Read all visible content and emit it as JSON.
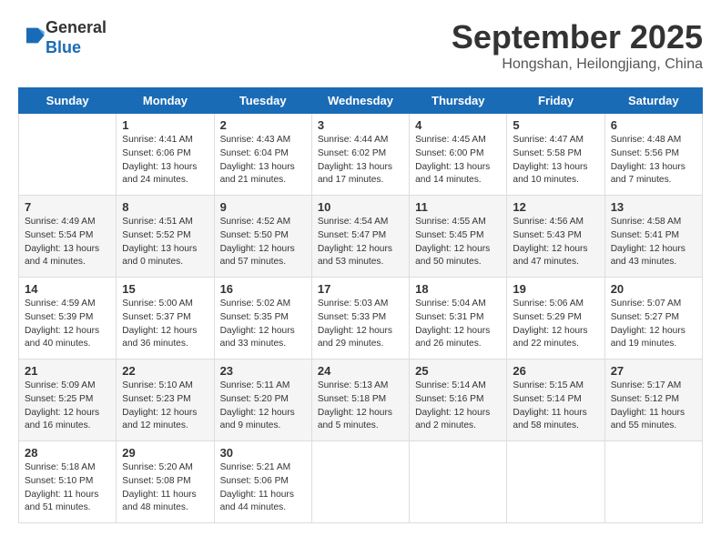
{
  "header": {
    "logo_line1": "General",
    "logo_line2": "Blue",
    "month": "September 2025",
    "location": "Hongshan, Heilongjiang, China"
  },
  "days_of_week": [
    "Sunday",
    "Monday",
    "Tuesday",
    "Wednesday",
    "Thursday",
    "Friday",
    "Saturday"
  ],
  "weeks": [
    [
      {
        "day": "",
        "info": ""
      },
      {
        "day": "1",
        "info": "Sunrise: 4:41 AM\nSunset: 6:06 PM\nDaylight: 13 hours\nand 24 minutes."
      },
      {
        "day": "2",
        "info": "Sunrise: 4:43 AM\nSunset: 6:04 PM\nDaylight: 13 hours\nand 21 minutes."
      },
      {
        "day": "3",
        "info": "Sunrise: 4:44 AM\nSunset: 6:02 PM\nDaylight: 13 hours\nand 17 minutes."
      },
      {
        "day": "4",
        "info": "Sunrise: 4:45 AM\nSunset: 6:00 PM\nDaylight: 13 hours\nand 14 minutes."
      },
      {
        "day": "5",
        "info": "Sunrise: 4:47 AM\nSunset: 5:58 PM\nDaylight: 13 hours\nand 10 minutes."
      },
      {
        "day": "6",
        "info": "Sunrise: 4:48 AM\nSunset: 5:56 PM\nDaylight: 13 hours\nand 7 minutes."
      }
    ],
    [
      {
        "day": "7",
        "info": "Sunrise: 4:49 AM\nSunset: 5:54 PM\nDaylight: 13 hours\nand 4 minutes."
      },
      {
        "day": "8",
        "info": "Sunrise: 4:51 AM\nSunset: 5:52 PM\nDaylight: 13 hours\nand 0 minutes."
      },
      {
        "day": "9",
        "info": "Sunrise: 4:52 AM\nSunset: 5:50 PM\nDaylight: 12 hours\nand 57 minutes."
      },
      {
        "day": "10",
        "info": "Sunrise: 4:54 AM\nSunset: 5:47 PM\nDaylight: 12 hours\nand 53 minutes."
      },
      {
        "day": "11",
        "info": "Sunrise: 4:55 AM\nSunset: 5:45 PM\nDaylight: 12 hours\nand 50 minutes."
      },
      {
        "day": "12",
        "info": "Sunrise: 4:56 AM\nSunset: 5:43 PM\nDaylight: 12 hours\nand 47 minutes."
      },
      {
        "day": "13",
        "info": "Sunrise: 4:58 AM\nSunset: 5:41 PM\nDaylight: 12 hours\nand 43 minutes."
      }
    ],
    [
      {
        "day": "14",
        "info": "Sunrise: 4:59 AM\nSunset: 5:39 PM\nDaylight: 12 hours\nand 40 minutes."
      },
      {
        "day": "15",
        "info": "Sunrise: 5:00 AM\nSunset: 5:37 PM\nDaylight: 12 hours\nand 36 minutes."
      },
      {
        "day": "16",
        "info": "Sunrise: 5:02 AM\nSunset: 5:35 PM\nDaylight: 12 hours\nand 33 minutes."
      },
      {
        "day": "17",
        "info": "Sunrise: 5:03 AM\nSunset: 5:33 PM\nDaylight: 12 hours\nand 29 minutes."
      },
      {
        "day": "18",
        "info": "Sunrise: 5:04 AM\nSunset: 5:31 PM\nDaylight: 12 hours\nand 26 minutes."
      },
      {
        "day": "19",
        "info": "Sunrise: 5:06 AM\nSunset: 5:29 PM\nDaylight: 12 hours\nand 22 minutes."
      },
      {
        "day": "20",
        "info": "Sunrise: 5:07 AM\nSunset: 5:27 PM\nDaylight: 12 hours\nand 19 minutes."
      }
    ],
    [
      {
        "day": "21",
        "info": "Sunrise: 5:09 AM\nSunset: 5:25 PM\nDaylight: 12 hours\nand 16 minutes."
      },
      {
        "day": "22",
        "info": "Sunrise: 5:10 AM\nSunset: 5:23 PM\nDaylight: 12 hours\nand 12 minutes."
      },
      {
        "day": "23",
        "info": "Sunrise: 5:11 AM\nSunset: 5:20 PM\nDaylight: 12 hours\nand 9 minutes."
      },
      {
        "day": "24",
        "info": "Sunrise: 5:13 AM\nSunset: 5:18 PM\nDaylight: 12 hours\nand 5 minutes."
      },
      {
        "day": "25",
        "info": "Sunrise: 5:14 AM\nSunset: 5:16 PM\nDaylight: 12 hours\nand 2 minutes."
      },
      {
        "day": "26",
        "info": "Sunrise: 5:15 AM\nSunset: 5:14 PM\nDaylight: 11 hours\nand 58 minutes."
      },
      {
        "day": "27",
        "info": "Sunrise: 5:17 AM\nSunset: 5:12 PM\nDaylight: 11 hours\nand 55 minutes."
      }
    ],
    [
      {
        "day": "28",
        "info": "Sunrise: 5:18 AM\nSunset: 5:10 PM\nDaylight: 11 hours\nand 51 minutes."
      },
      {
        "day": "29",
        "info": "Sunrise: 5:20 AM\nSunset: 5:08 PM\nDaylight: 11 hours\nand 48 minutes."
      },
      {
        "day": "30",
        "info": "Sunrise: 5:21 AM\nSunset: 5:06 PM\nDaylight: 11 hours\nand 44 minutes."
      },
      {
        "day": "",
        "info": ""
      },
      {
        "day": "",
        "info": ""
      },
      {
        "day": "",
        "info": ""
      },
      {
        "day": "",
        "info": ""
      }
    ]
  ]
}
